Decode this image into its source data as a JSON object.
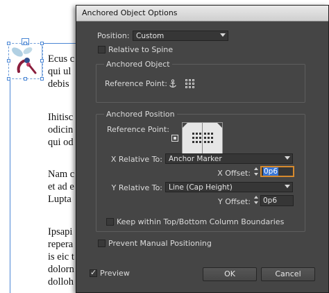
{
  "document": {
    "paragraphs": [
      [
        "Ecus c",
        "qui ul",
        "debis"
      ],
      [
        "Ihitisc",
        "odicin",
        "qui od"
      ],
      [
        "Nam c",
        "et ad e",
        "Lupta"
      ],
      [
        "Ipsapi",
        "repera",
        "is eic t",
        "dolorn",
        "dolloh"
      ]
    ]
  },
  "dialog": {
    "title": "Anchored Object Options",
    "position_label": "Position:",
    "position_value": "Custom",
    "relative_to_spine_label": "Relative to Spine",
    "anchored_object": {
      "group_title": "Anchored Object",
      "reference_point_label": "Reference Point:"
    },
    "anchored_position": {
      "group_title": "Anchored Position",
      "reference_point_label": "Reference Point:",
      "x_relative_label": "X Relative To:",
      "x_relative_value": "Anchor Marker",
      "x_offset_label": "X Offset:",
      "x_offset_value": "0p6",
      "y_relative_label": "Y Relative To:",
      "y_relative_value": "Line (Cap Height)",
      "y_offset_label": "Y Offset:",
      "y_offset_value": "0p6",
      "keep_within_label": "Keep within Top/Bottom Column Boundaries"
    },
    "prevent_manual_label": "Prevent Manual Positioning",
    "preview_label": "Preview",
    "preview_checked": true,
    "ok_label": "OK",
    "cancel_label": "Cancel"
  },
  "colors": {
    "dialog_bg": "#454545",
    "focus_ring": "#d68a2e",
    "selection": "#3875d6",
    "frame_guide": "#4a86d4"
  }
}
